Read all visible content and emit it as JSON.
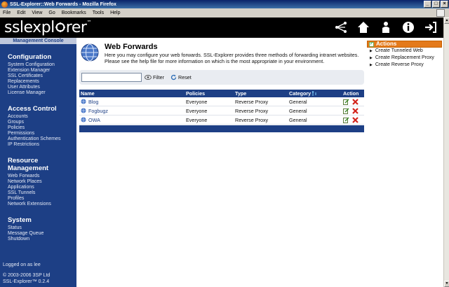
{
  "window": {
    "title": "SSL-Explorer::Web Forwards - Mozilla Firefox"
  },
  "menu": [
    "File",
    "Edit",
    "View",
    "Go",
    "Bookmarks",
    "Tools",
    "Help"
  ],
  "header": {
    "logo": "sslexpl",
    "logo_tail": "rer",
    "tm": "™"
  },
  "sidebar": {
    "console_label": "Management Console",
    "sections": [
      {
        "title": "Configuration",
        "items": [
          "System Configuration",
          "Extension Manager",
          "SSL Certificates",
          "Replacements",
          "User Attributes",
          "License Manager"
        ]
      },
      {
        "title": "Access Control",
        "items": [
          "Accounts",
          "Groups",
          "Policies",
          "Permissions",
          "Authentication Schemes",
          "IP Restrictions"
        ]
      },
      {
        "title": "Resource Management",
        "items": [
          "Web Forwards",
          "Network Places",
          "Applications",
          "SSL Tunnels",
          "Profiles",
          "Network Extensions"
        ]
      },
      {
        "title": "System",
        "items": [
          "Status",
          "Message Queue",
          "Shutdown"
        ]
      }
    ],
    "logged_on": "Logged on as lee",
    "copyright": "© 2003-2006 3SP Ltd",
    "version": "SSL-Explorer™ 0.2.4"
  },
  "page": {
    "title": "Web Forwards",
    "description": "Here you may configure your web forwards. SSL-Explorer provides three methods of forwarding intranet websites. Please see the help file for more information on which is the most appropriate in your environment."
  },
  "actions": {
    "title": "Actions",
    "items": [
      "Create Tunneled Web",
      "Create Replacement Proxy",
      "Create Reverse Proxy"
    ]
  },
  "filter": {
    "value": "",
    "filter_label": "Filter",
    "reset_label": "Reset"
  },
  "table": {
    "headers": {
      "name": "Name",
      "policies": "Policies",
      "type": "Type",
      "category": "Category",
      "action": "Action"
    },
    "rows": [
      {
        "name": "Blog",
        "policies": "Everyone",
        "type": "Reverse Proxy",
        "category": "General"
      },
      {
        "name": "Fogbugz",
        "policies": "Everyone",
        "type": "Reverse Proxy",
        "category": "General"
      },
      {
        "name": "OWA",
        "policies": "Everyone",
        "type": "Reverse Proxy",
        "category": "General"
      }
    ]
  },
  "colors": {
    "sidebar": "#1d3f85",
    "actions_header": "#e47a1b",
    "table_header": "#1d3f85"
  },
  "icons": [
    "network-icon",
    "home-icon",
    "user-icon",
    "info-icon",
    "logout-icon",
    "globe-icon",
    "edit-icon",
    "delete-icon",
    "sort-icon"
  ]
}
